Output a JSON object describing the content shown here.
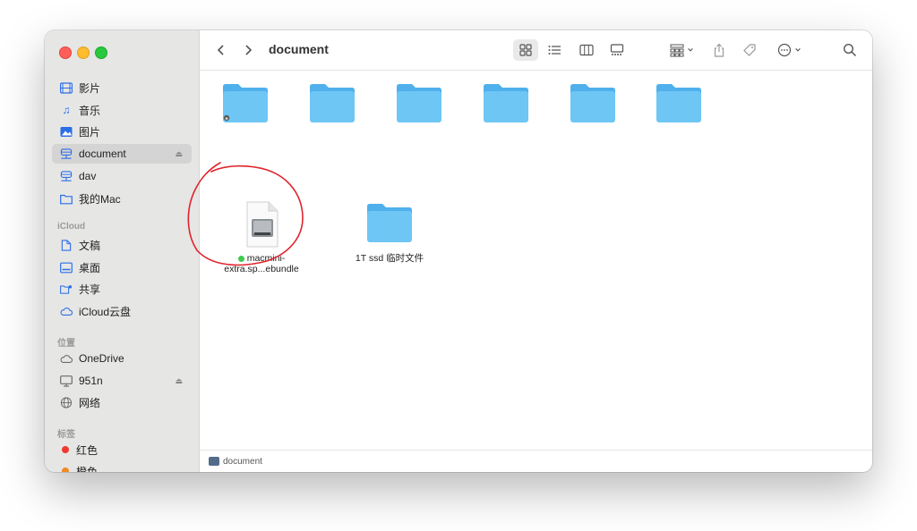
{
  "window": {
    "title": "document"
  },
  "sidebar": {
    "favorites": [
      {
        "label": "影片",
        "icon": "film-icon"
      },
      {
        "label": "音乐",
        "icon": "music-icon"
      },
      {
        "label": "图片",
        "icon": "photo-icon"
      },
      {
        "label": "document",
        "icon": "network-drive-icon",
        "active": true,
        "eject": true
      },
      {
        "label": "dav",
        "icon": "network-drive-icon"
      },
      {
        "label": "我的Mac",
        "icon": "folder-icon"
      }
    ],
    "icloud_header": "iCloud",
    "icloud": [
      {
        "label": "文稿",
        "icon": "document-icon"
      },
      {
        "label": "桌面",
        "icon": "desktop-icon"
      },
      {
        "label": "共享",
        "icon": "shared-folder-icon"
      },
      {
        "label": "iCloud云盘",
        "icon": "cloud-icon"
      }
    ],
    "locations_header": "位置",
    "locations": [
      {
        "label": "OneDrive",
        "icon": "cloud-icon"
      },
      {
        "label": "951n",
        "icon": "monitor-icon",
        "eject": true
      },
      {
        "label": "网络",
        "icon": "globe-icon"
      }
    ],
    "tags_header": "标签",
    "tags": [
      {
        "label": "红色",
        "color": "#f0392f"
      },
      {
        "label": "橙色",
        "color": "#f08a24"
      }
    ]
  },
  "toolbar": {
    "back_icon": "chevron-left-icon",
    "forward_icon": "chevron-right-icon",
    "title": "document"
  },
  "files": [
    {
      "label": "",
      "type": "folder",
      "locked": true
    },
    {
      "label": "",
      "type": "folder"
    },
    {
      "label": "",
      "type": "folder"
    },
    {
      "label": "",
      "type": "folder"
    },
    {
      "label": "",
      "type": "folder"
    },
    {
      "label": "",
      "type": "folder"
    },
    {
      "label_line1": "macmini-",
      "label_line2": "extra.sp...ebundle",
      "type": "disk-image",
      "tag_color": "#3ecb4e"
    },
    {
      "label": "1T ssd 临时文件",
      "type": "folder"
    }
  ],
  "statusbar": {
    "path": "document"
  },
  "colors": {
    "accent": "#2a6ee8",
    "folder_top": "#5ab8f0",
    "folder_body": "#6ec6f5",
    "annotation": "#e0242c"
  }
}
